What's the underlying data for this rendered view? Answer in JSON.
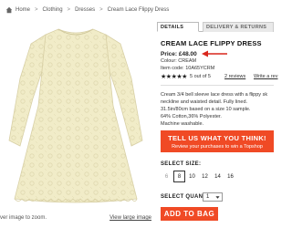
{
  "breadcrumb": {
    "home": "Home",
    "items": [
      "Clothing",
      "Dresses"
    ],
    "current": "Cream Lace Flippy Dress"
  },
  "tabs": {
    "details": "DETAILS",
    "delivery": "DELIVERY & RETURNS"
  },
  "product": {
    "title": "CREAM LACE FLIPPY DRESS",
    "price": "Price: £48.00",
    "colour": "Colour: CREAM",
    "item_code": "Item code: 10A65YCRM",
    "stars_filled": 4,
    "stars_total": 5,
    "rating_text": "5 out of 5",
    "reviews": "2 reviews",
    "write_review": "Write a rev",
    "description": [
      "Cream 3/4 bell sleeve lace dress with a flippy sk",
      "neckline and waisted detail. Fully lined.",
      "31.5in/80cm based on a size 10 sample.",
      "64% Cotton,36% Polyester.",
      "Machine washable."
    ]
  },
  "promo": {
    "main": "TELL US WHAT YOU THINK!",
    "sub": "Review your purchases to win a Topshop"
  },
  "size": {
    "label": "SELECT SIZE:",
    "options": [
      "6",
      "8",
      "10",
      "12",
      "14",
      "16"
    ],
    "selected": "8",
    "disabled": [
      "6"
    ]
  },
  "quantity": {
    "label": "SELECT QUANTITY:",
    "value": "1"
  },
  "add_to_bag": "ADD TO BAG",
  "image_footer": {
    "zoom_hint": "ver image to zoom.",
    "view_large": "View large image"
  },
  "colors": {
    "accent": "#f04a25",
    "arrow": "#d9261c",
    "dress": "#f1ecc8"
  },
  "icons": {
    "home": "home-icon",
    "arrow": "arrow-left-icon",
    "star": "star-icon",
    "dropdown": "chevron-down-icon"
  }
}
